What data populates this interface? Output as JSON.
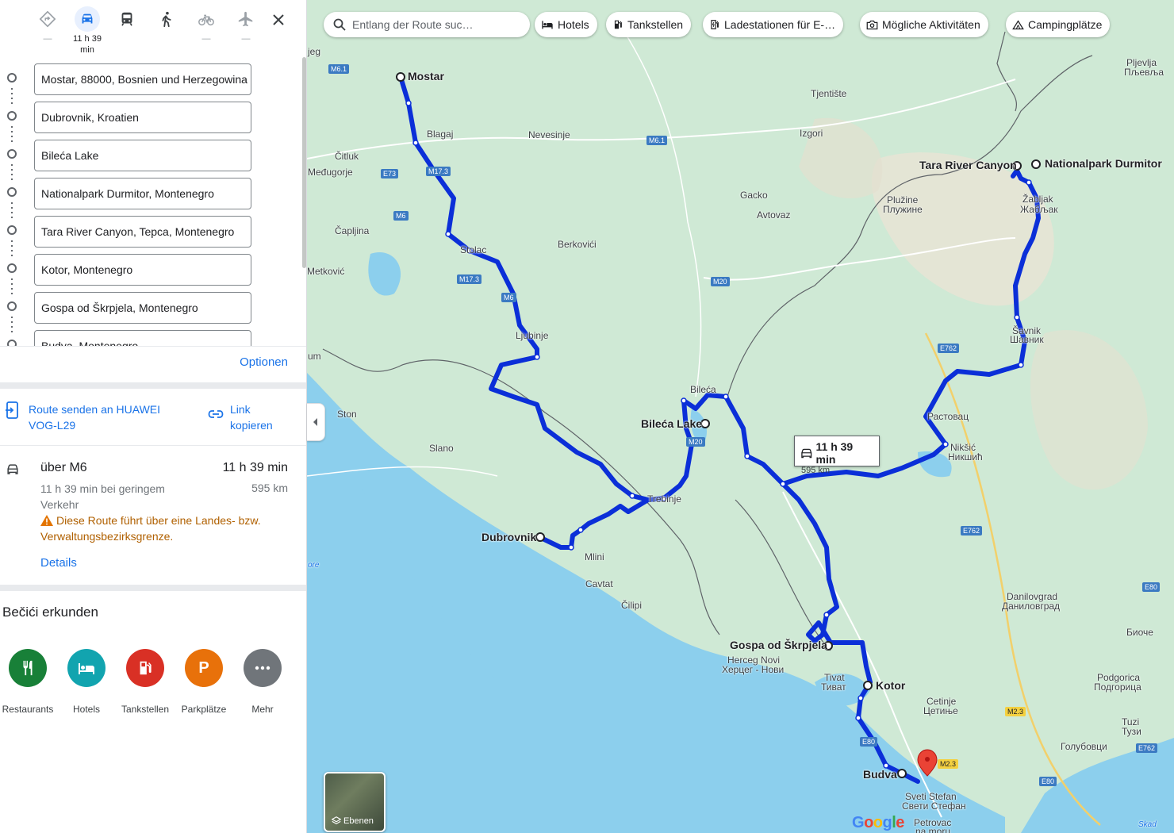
{
  "travel_modes": [
    {
      "name": "best",
      "sub": "—"
    },
    {
      "name": "car",
      "sub": "11 h 39 min"
    },
    {
      "name": "transit",
      "sub": ""
    },
    {
      "name": "walk",
      "sub": ""
    },
    {
      "name": "bike",
      "sub": "—"
    },
    {
      "name": "flight",
      "sub": "—"
    }
  ],
  "stops": [
    "Mostar, 88000, Bosnien und Herzegowina",
    "Dubrovnik, Kroatien",
    "Bileća Lake",
    "Nationalpark Durmitor, Montenegro",
    "Tara River Canyon, Tepca, Montenegro",
    "Kotor, Montenegro",
    "Gospa od Škrpjela, Montenegro",
    "Budva, Montenegro"
  ],
  "options_label": "Optionen",
  "send_route_label": "Route senden an HUAWEI VOG-L29",
  "copy_link_label": "Link kopieren",
  "route": {
    "via": "über M6",
    "time": "11 h 39 min",
    "traffic": "11 h 39 min bei geringem Verkehr",
    "distance": "595 km",
    "warning": "Diese Route führt über eine Landes- bzw. Verwaltungsbezirksgrenze.",
    "details": "Details"
  },
  "explore": {
    "title": "Bečići erkunden",
    "categories": [
      {
        "label": "Restaurants",
        "color": "#188038",
        "icon": "restaurant-icon"
      },
      {
        "label": "Hotels",
        "color": "#12a4af",
        "icon": "hotel-icon"
      },
      {
        "label": "Tankstellen",
        "color": "#d93025",
        "icon": "gas-station-icon"
      },
      {
        "label": "Parkplätze",
        "color": "#e8710a",
        "icon": "parking-icon"
      },
      {
        "label": "Mehr",
        "color": "#70757a",
        "icon": "more-icon"
      }
    ]
  },
  "map": {
    "search_placeholder": "Entlang der Route suc…",
    "chips": [
      "Hotels",
      "Tankstellen",
      "Ladestationen für E-…",
      "Mögliche Aktivitäten",
      "Campingplätze"
    ],
    "callout_time": "11 h 39 min",
    "callout_distance": "595 km",
    "layers_label": "Ebenen",
    "google_logo": "Google",
    "place_labels": {
      "mostar": "Mostar",
      "dubrovnik": "Dubrovnik",
      "bileca_lake": "Bileća Lake",
      "tara": "Tara River Canyon",
      "durmitor": "Nationalpark Durmitor",
      "gospa": "Gospa od Škrpjela",
      "kotor": "Kotor",
      "budva": "Budva",
      "blagaj": "Blagaj",
      "nevesinje": "Nevesinje",
      "citluk": "Čitluk",
      "medugorje": "Međugorje",
      "capljina": "Čapljina",
      "stolac": "Stolac",
      "berkovici": "Berkovići",
      "ljubinje": "Ljubinje",
      "metkovic": "Metković",
      "ston": "Ston",
      "slano": "Slano",
      "trebinje": "Trebinje",
      "mlini": "Mlini",
      "cavtat": "Cavtat",
      "cilipi": "Čilipi",
      "bileca": "Bileća",
      "gacko": "Gacko",
      "avtovaz": "Avtovaz",
      "tjentiste": "Tjentište",
      "izgori": "Izgori",
      "pluzine": "Plužine",
      "pluzine_cyr": "Плужине",
      "zabljak": "Žabljak",
      "zabljak_cyr": "Жабљак",
      "savnik": "Šavnik",
      "savnik_cyr": "Шавник",
      "rastovac": "Растовац",
      "niksic": "Nikšić",
      "niksic_cyr": "Никшић",
      "danilovgrad": "Danilovgrad",
      "danilovgrad_cyr": "Даниловград",
      "herceg": "Herceg Novi",
      "herceg_cyr": "Херцег - Нови",
      "tivat": "Tivat",
      "tivat_cyr": "Тиват",
      "cetinje": "Cetinje",
      "cetinje_cyr": "Цетиње",
      "podgorica": "Podgorica",
      "podgorica_cyr": "Подгорица",
      "tuzi": "Tuzi",
      "tuzi_cyr": "Тузи",
      "golubovci": "Голубовци",
      "bioce": "Биоче",
      "pljevlja": "Pljevlja",
      "pljevlja_cyr": "Пљевља",
      "sveti_stefan": "Sveti Stefan",
      "sveti_stefan_cyr": "Свети Стефан",
      "petrovac": "Petrovac",
      "petrovac_cyr": "na moru",
      "jeg": "jeg",
      "um": "um",
      "ore": "ore",
      "skad": "Skad"
    },
    "road_shields": {
      "m61a": "M6.1",
      "m61b": "M6.1",
      "e73": "E73",
      "m6a": "M6",
      "m173a": "M17.3",
      "m173b": "M17.3",
      "m6b": "M6",
      "m20a": "M20",
      "m20b": "M20",
      "e762a": "E762",
      "e762b": "E762",
      "e762c": "E762",
      "e80a": "E80",
      "e80b": "E80",
      "e80c": "E80",
      "m23a": "M2.3",
      "m23b": "M2.3"
    }
  }
}
